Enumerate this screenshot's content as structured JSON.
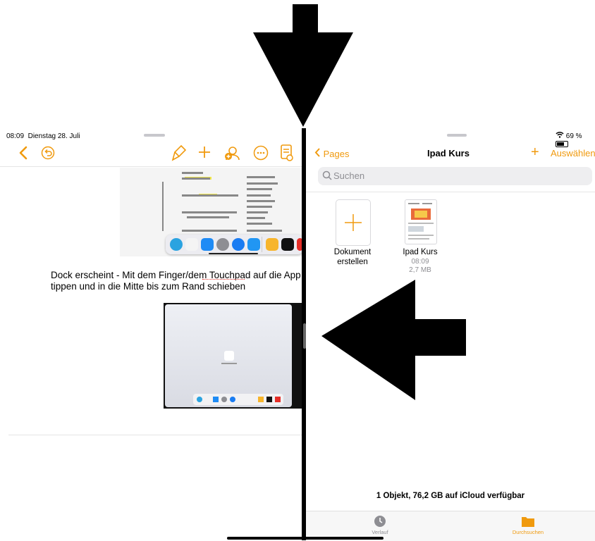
{
  "left": {
    "status": {
      "time": "08:09",
      "date": "Dienstag 28. Juli"
    },
    "toolbar": {
      "back": "back-chevron-icon",
      "undo": "undo-icon",
      "format": "paintbrush-icon",
      "add": "plus-icon",
      "collaborate": "add-person-icon",
      "more": "more-icon",
      "doc_options": "document-icon"
    },
    "caption": "Dock erscheint - Mit dem Finger/dem Touchpad auf die App tippen und in die Mitte bis zum Rand schieben",
    "misspelled": "Touchpad"
  },
  "right": {
    "status": {
      "wifi": "wifi-icon",
      "battery": "69 %"
    },
    "nav": {
      "back_label": "Pages",
      "title": "Ipad Kurs",
      "add": "+",
      "select_label": "Auswählen"
    },
    "search": {
      "placeholder": "Suchen"
    },
    "items": [
      {
        "name_line1": "Dokument",
        "name_line2": "erstellen",
        "kind": "new"
      },
      {
        "name": "Ipad Kurs",
        "time": "08:09",
        "size": "2,7 MB",
        "kind": "file"
      }
    ],
    "storage": "1 Objekt, 76,2 GB auf iCloud verfügbar",
    "tabs": [
      {
        "label": "Verlauf",
        "icon": "clock-icon",
        "active": false
      },
      {
        "label": "Durchsuchen",
        "icon": "folder-icon",
        "active": true
      }
    ]
  },
  "colors": {
    "accent": "#f09a0e",
    "inactive": "#8e8e93"
  }
}
